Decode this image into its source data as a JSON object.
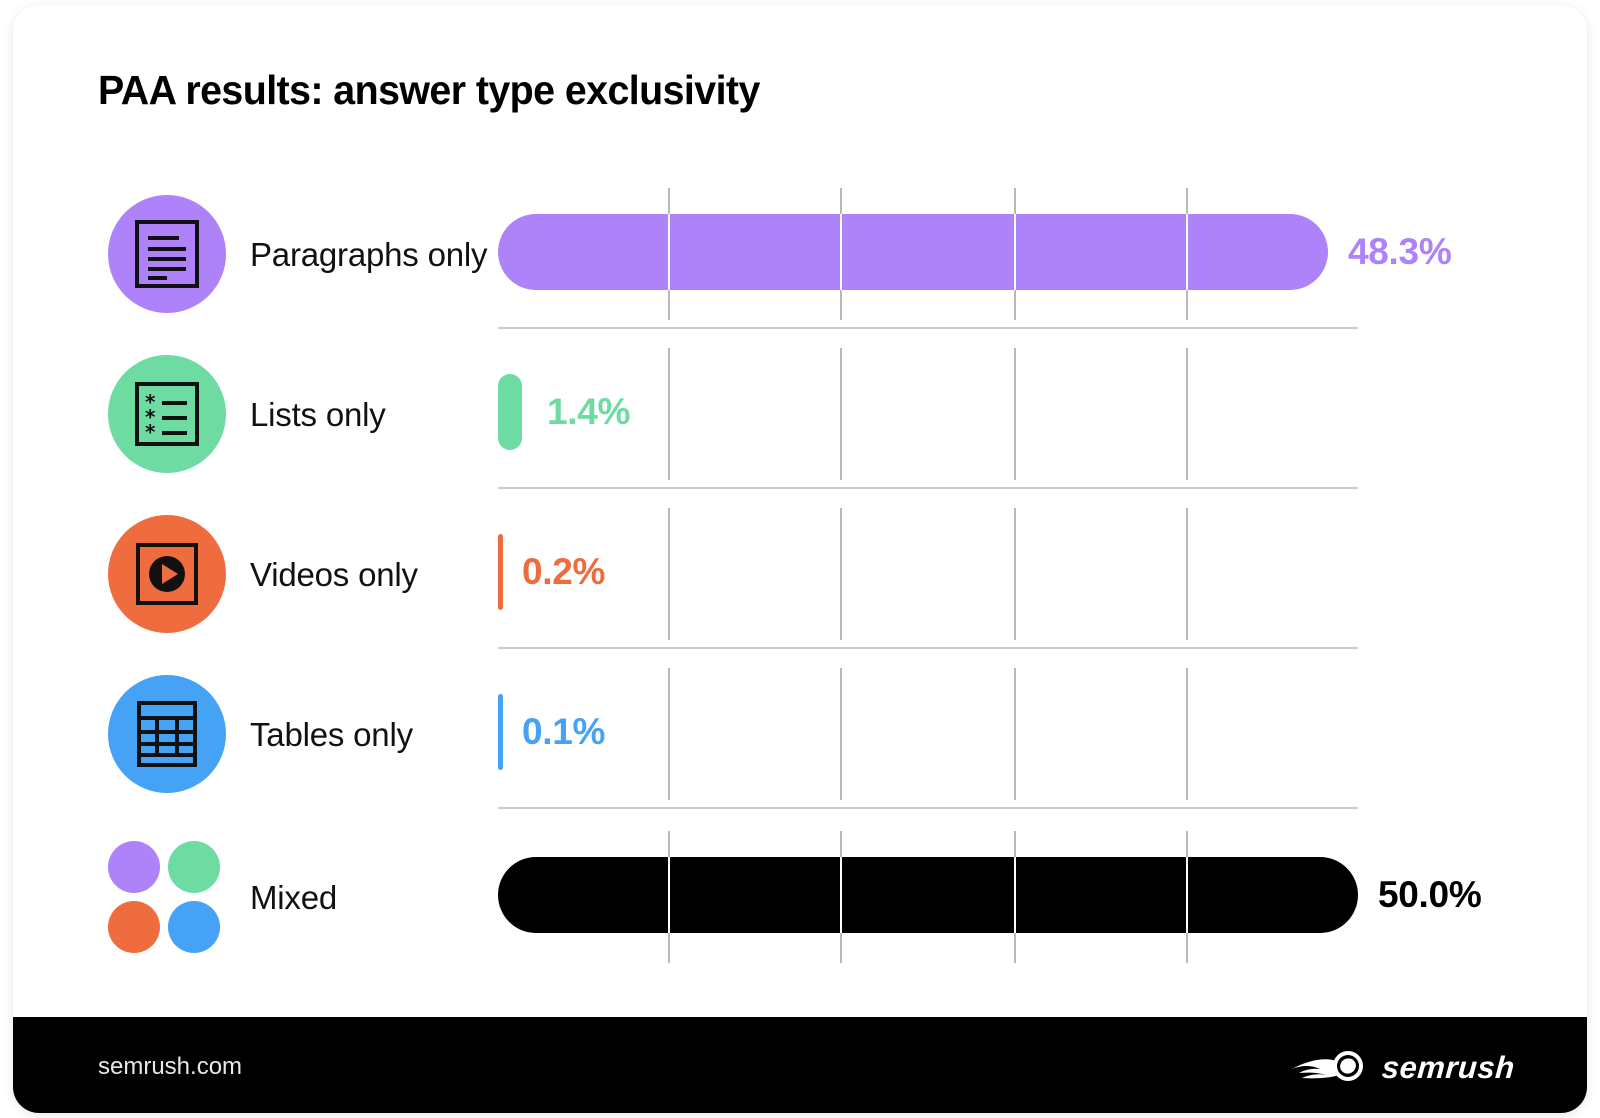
{
  "card": {
    "title": "PAA results: answer type exclusivity"
  },
  "chart_data": {
    "type": "bar",
    "orientation": "horizontal",
    "title": "PAA results: answer type exclusivity",
    "xlabel": "",
    "ylabel": "",
    "xlim": [
      0,
      50
    ],
    "unit": "%",
    "grid": true,
    "gridlines_x": [
      10,
      20,
      30,
      40
    ],
    "legend": "none",
    "categories": [
      "Paragraphs only",
      "Lists only",
      "Videos only",
      "Tables only",
      "Mixed"
    ],
    "values": [
      48.3,
      1.4,
      0.2,
      0.1,
      50.0
    ],
    "value_labels": [
      "48.3%",
      "1.4%",
      "0.2%",
      "0.1%",
      "50.0%"
    ],
    "colors": [
      "#AE82F8",
      "#6EDCA2",
      "#EE6C3E",
      "#45A2F5",
      "#000000"
    ]
  },
  "rows": [
    {
      "label": "Paragraphs only",
      "value": 48.3,
      "value_label": "48.3%",
      "color": "#AE82F8",
      "icon": "document-lines-icon",
      "icon_circle_color": "#AE82F8"
    },
    {
      "label": "Lists only",
      "value": 1.4,
      "value_label": "1.4%",
      "color": "#6EDCA2",
      "icon": "bullet-list-icon",
      "icon_circle_color": "#6EDCA2"
    },
    {
      "label": "Videos only",
      "value": 0.2,
      "value_label": "0.2%",
      "color": "#EE6C3E",
      "icon": "video-play-icon",
      "icon_circle_color": "#EE6C3E"
    },
    {
      "label": "Tables only",
      "value": 0.1,
      "value_label": "0.1%",
      "color": "#45A2F5",
      "icon": "table-grid-icon",
      "icon_circle_color": "#45A2F5"
    },
    {
      "label": "Mixed",
      "value": 50.0,
      "value_label": "50.0%",
      "color": "#000000",
      "icon": "four-dots-icon",
      "icon_circle_color": "transparent",
      "dot_colors": [
        "#AE82F8",
        "#6EDCA2",
        "#EE6C3E",
        "#45A2F5"
      ]
    }
  ],
  "footer": {
    "url": "semrush.com",
    "logo_word": "semrush",
    "logo_mark": "semrush-flame-icon"
  }
}
